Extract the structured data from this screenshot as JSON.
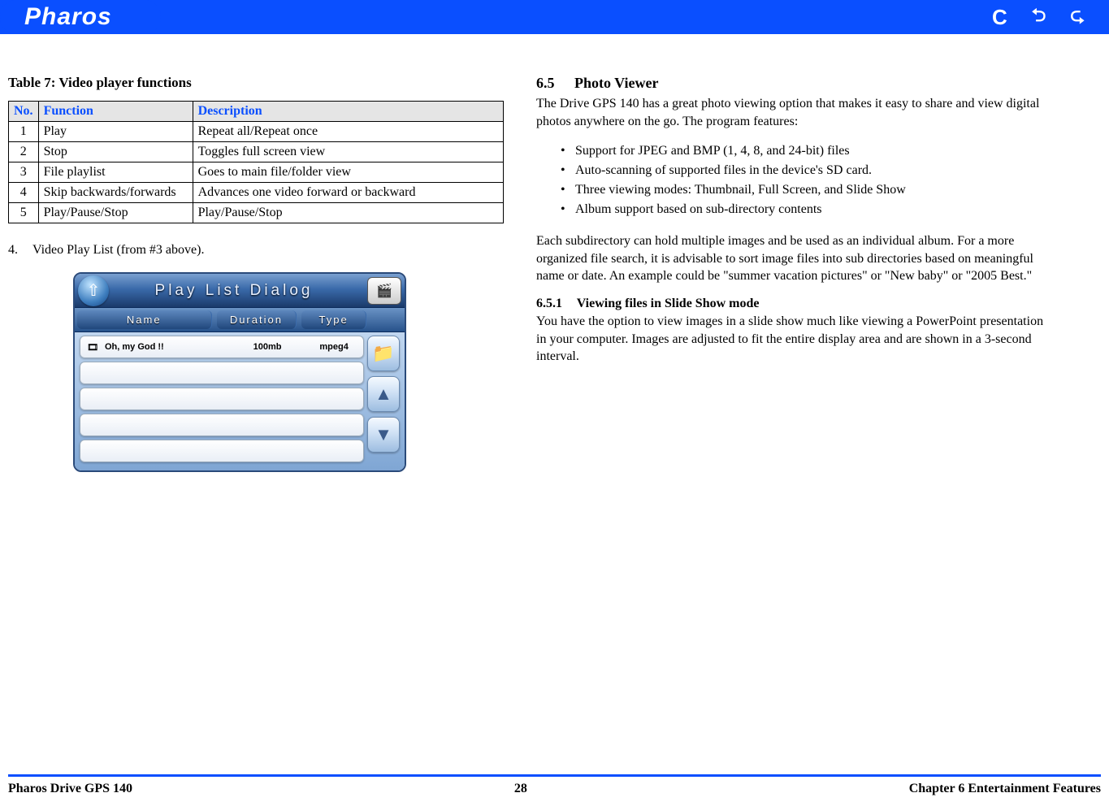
{
  "header": {
    "brand": "Pharos"
  },
  "left": {
    "table_caption": "Table 7: Video player functions",
    "table_headers": {
      "no": "No.",
      "func": "Function",
      "desc": "Description"
    },
    "rows": [
      {
        "no": "1",
        "func": "Play",
        "desc": "Repeat all/Repeat once"
      },
      {
        "no": "2",
        "func": "Stop",
        "desc": "Toggles full screen view"
      },
      {
        "no": "3",
        "func": "File playlist",
        "desc": "Goes to main file/folder view"
      },
      {
        "no": "4",
        "func": "Skip backwards/forwards",
        "desc": "Advances one video forward or backward"
      },
      {
        "no": "5",
        "func": "Play/Pause/Stop",
        "desc": "Play/Pause/Stop"
      }
    ],
    "list_item_no": "4.",
    "list_item_text": "Video Play List (from #3 above).",
    "dialog": {
      "title": "Play List Dialog",
      "cols": {
        "name": "Name",
        "duration": "Duration",
        "type": "Type"
      },
      "row1": {
        "name": "Oh, my God !!",
        "duration": "100mb",
        "type": "mpeg4"
      }
    }
  },
  "right": {
    "sec_no": "6.5",
    "sec_title": "Photo Viewer",
    "intro": "The Drive GPS 140 has a great photo viewing option that makes it easy to share and view digital photos anywhere on the go. The program features:",
    "features": [
      "Support for JPEG and BMP (1, 4, 8, and 24-bit) files",
      "Auto-scanning of supported files in the device's SD card.",
      "Three viewing modes: Thumbnail, Full Screen, and Slide Show",
      "Album support based on sub-directory contents"
    ],
    "para2": "Each subdirectory can hold multiple images and be used as an individual album. For a more organized file search, it is advisable to sort image files into sub directories based on meaningful name or date. An example could be \"summer vacation pictures\" or \"New baby\" or \"2005 Best.\"",
    "sub_no": "6.5.1",
    "sub_title": "Viewing files in Slide Show mode",
    "sub_para": "You have the option to view images in a slide show much like viewing a PowerPoint presentation in your computer. Images are adjusted to fit the entire display area and are shown in a 3-second interval."
  },
  "footer": {
    "left": "Pharos Drive GPS 140",
    "center": "28",
    "right": "Chapter 6 Entertainment Features"
  }
}
